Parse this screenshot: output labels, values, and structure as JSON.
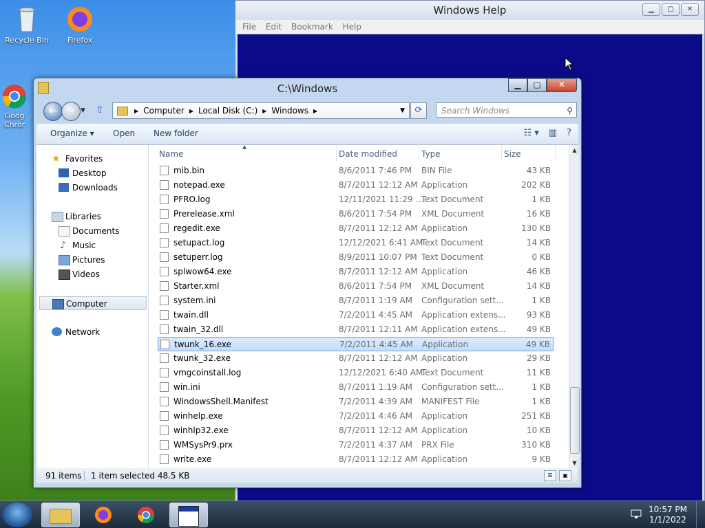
{
  "desktop": {
    "icons": [
      {
        "label": "Recycle Bin"
      },
      {
        "label": "Firefox"
      },
      {
        "label": "Goog Chror"
      }
    ]
  },
  "help_window": {
    "title": "Windows Help",
    "menu": [
      "File",
      "Edit",
      "Bookmark",
      "Help"
    ],
    "client_color": "#0b0b8a"
  },
  "explorer": {
    "title": "C:\\Windows",
    "breadcrumb": [
      "Computer",
      "Local Disk (C:)",
      "Windows"
    ],
    "search_placeholder": "Search Windows",
    "commands": {
      "organize": "Organize ▾",
      "open": "Open",
      "new_folder": "New folder"
    },
    "nav": {
      "favorites": "Favorites",
      "desktop": "Desktop",
      "downloads": "Downloads",
      "libraries": "Libraries",
      "documents": "Documents",
      "music": "Music",
      "pictures": "Pictures",
      "videos": "Videos",
      "computer": "Computer",
      "network": "Network"
    },
    "columns": {
      "name": "Name",
      "date": "Date modified",
      "type": "Type",
      "size": "Size"
    },
    "files": [
      {
        "name": "mib.bin",
        "date": "8/6/2011 7:46 PM",
        "type": "BIN File",
        "size": "43 KB",
        "selected": false
      },
      {
        "name": "notepad.exe",
        "date": "8/7/2011 12:12 AM",
        "type": "Application",
        "size": "202 KB",
        "selected": false
      },
      {
        "name": "PFRO.log",
        "date": "12/11/2021 11:29 ...",
        "type": "Text Document",
        "size": "1 KB",
        "selected": false
      },
      {
        "name": "Prerelease.xml",
        "date": "8/6/2011 7:54 PM",
        "type": "XML Document",
        "size": "16 KB",
        "selected": false
      },
      {
        "name": "regedit.exe",
        "date": "8/7/2011 12:12 AM",
        "type": "Application",
        "size": "130 KB",
        "selected": false
      },
      {
        "name": "setupact.log",
        "date": "12/12/2021 6:41 AM",
        "type": "Text Document",
        "size": "14 KB",
        "selected": false
      },
      {
        "name": "setuperr.log",
        "date": "8/9/2011 10:07 PM",
        "type": "Text Document",
        "size": "0 KB",
        "selected": false
      },
      {
        "name": "splwow64.exe",
        "date": "8/7/2011 12:12 AM",
        "type": "Application",
        "size": "46 KB",
        "selected": false
      },
      {
        "name": "Starter.xml",
        "date": "8/6/2011 7:54 PM",
        "type": "XML Document",
        "size": "14 KB",
        "selected": false
      },
      {
        "name": "system.ini",
        "date": "8/7/2011 1:19 AM",
        "type": "Configuration sett...",
        "size": "1 KB",
        "selected": false
      },
      {
        "name": "twain.dll",
        "date": "7/2/2011 4:45 AM",
        "type": "Application extens...",
        "size": "93 KB",
        "selected": false
      },
      {
        "name": "twain_32.dll",
        "date": "8/7/2011 12:11 AM",
        "type": "Application extens...",
        "size": "49 KB",
        "selected": false
      },
      {
        "name": "twunk_16.exe",
        "date": "7/2/2011 4:45 AM",
        "type": "Application",
        "size": "49 KB",
        "selected": true
      },
      {
        "name": "twunk_32.exe",
        "date": "8/7/2011 12:12 AM",
        "type": "Application",
        "size": "29 KB",
        "selected": false
      },
      {
        "name": "vmgcoinstall.log",
        "date": "12/12/2021 6:40 AM",
        "type": "Text Document",
        "size": "11 KB",
        "selected": false
      },
      {
        "name": "win.ini",
        "date": "8/7/2011 1:19 AM",
        "type": "Configuration sett...",
        "size": "1 KB",
        "selected": false
      },
      {
        "name": "WindowsShell.Manifest",
        "date": "7/2/2011 4:39 AM",
        "type": "MANIFEST File",
        "size": "1 KB",
        "selected": false
      },
      {
        "name": "winhelp.exe",
        "date": "7/2/2011 4:46 AM",
        "type": "Application",
        "size": "251 KB",
        "selected": false
      },
      {
        "name": "winhlp32.exe",
        "date": "8/7/2011 12:12 AM",
        "type": "Application",
        "size": "10 KB",
        "selected": false
      },
      {
        "name": "WMSysPr9.prx",
        "date": "7/2/2011 4:37 AM",
        "type": "PRX File",
        "size": "310 KB",
        "selected": false
      },
      {
        "name": "write.exe",
        "date": "8/7/2011 12:12 AM",
        "type": "Application",
        "size": "9 KB",
        "selected": false
      }
    ],
    "status": {
      "count": "91 items",
      "selection": "1 item selected 48.5 KB"
    }
  },
  "taskbar": {
    "time": "10:57 PM",
    "date": "1/1/2022"
  }
}
